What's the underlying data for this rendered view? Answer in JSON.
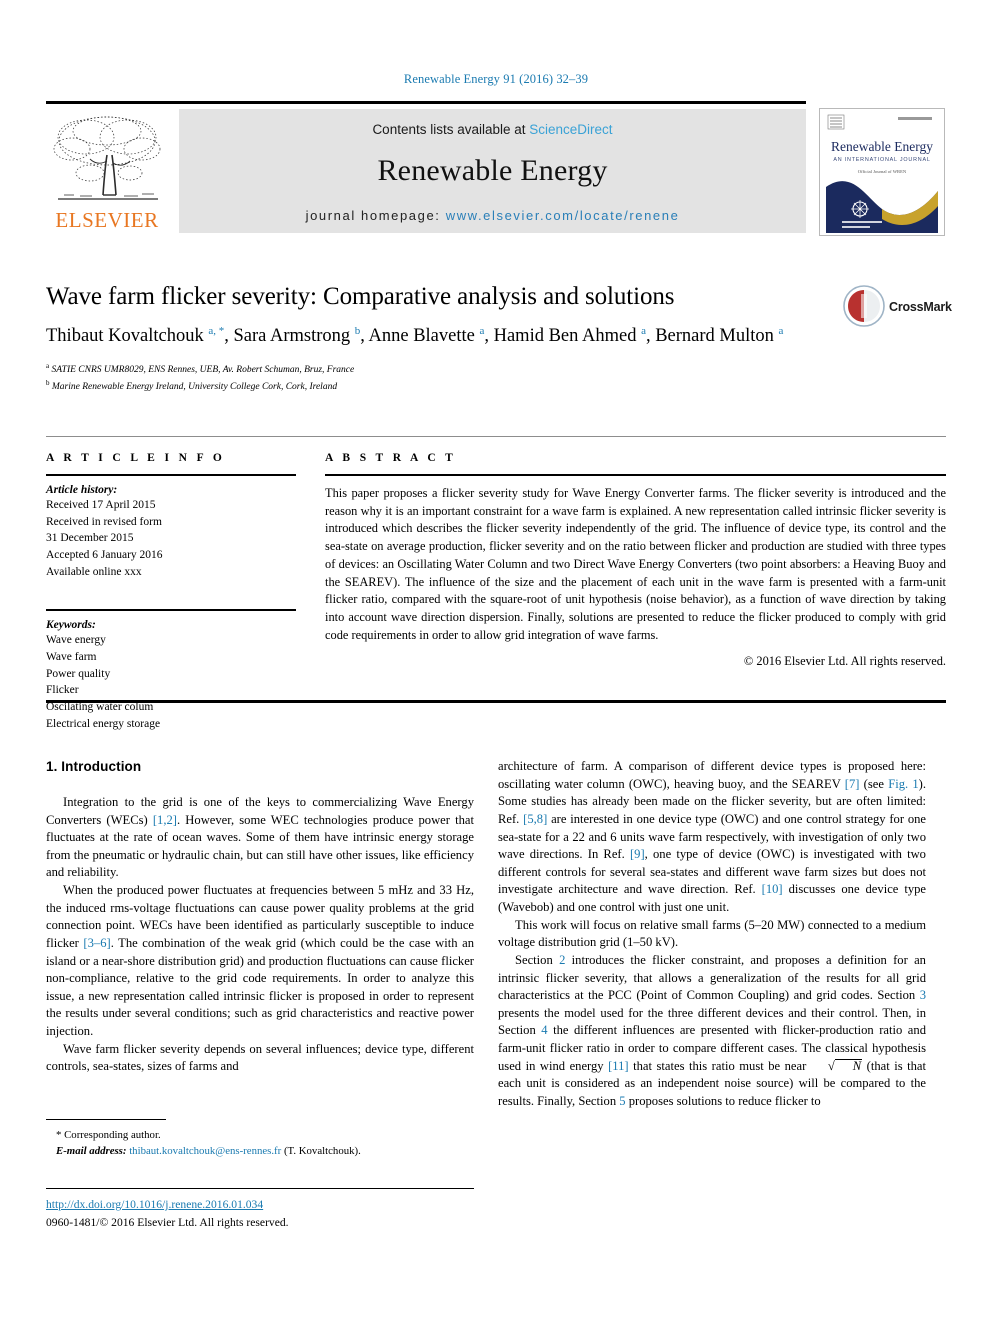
{
  "running_head": "Renewable Energy 91 (2016) 32–39",
  "masthead": {
    "contents_prefix": "Contents lists available at ",
    "contents_link": "ScienceDirect",
    "journal_name": "Renewable Energy",
    "homepage_prefix": "journal homepage: ",
    "homepage_url": "www.elsevier.com/locate/renene",
    "publisher": "ELSEVIER",
    "cover": {
      "title": "Renewable Energy",
      "subtitle": "AN INTERNATIONAL JOURNAL",
      "tagline": "Official Journal of WREN"
    }
  },
  "crossmark": {
    "label": "CrossMark"
  },
  "article": {
    "title": "Wave farm flicker severity: Comparative analysis and solutions",
    "authors_html": "Thibaut Kovaltchouk <sup>a, *</sup>, Sara Armstrong <sup>b</sup>, Anne Blavette <sup>a</sup>, Hamid Ben Ahmed <sup>a</sup>, Bernard Multon <sup>a</sup>",
    "affiliations": [
      {
        "marker": "a",
        "text": "SATIE CNRS UMR8029, ENS Rennes, UEB, Av. Robert Schuman, Bruz, France"
      },
      {
        "marker": "b",
        "text": "Marine Renewable Energy Ireland, University College Cork, Cork, Ireland"
      }
    ]
  },
  "article_info": {
    "heading": "A R T I C L E   I N F O",
    "history_label": "Article history:",
    "history": [
      "Received 17 April 2015",
      "Received in revised form",
      "31 December 2015",
      "Accepted 6 January 2016",
      "Available online xxx"
    ],
    "keywords_label": "Keywords:",
    "keywords": [
      "Wave energy",
      "Wave farm",
      "Power quality",
      "Flicker",
      "Oscilating water colum",
      "Electrical energy storage"
    ]
  },
  "abstract": {
    "heading": "A B S T R A C T",
    "text": "This paper proposes a flicker severity study for Wave Energy Converter farms. The flicker severity is introduced and the reason why it is an important constraint for a wave farm is explained. A new representation called intrinsic flicker severity is introduced which describes the flicker severity independently of the grid. The influence of device type, its control and the sea-state on average production, flicker severity and on the ratio between flicker and production are studied with three types of devices: an Oscillating Water Column and two Direct Wave Energy Converters (two point absorbers: a Heaving Buoy and the SEAREV). The influence of the size and the placement of each unit in the wave farm is presented with a farm-unit flicker ratio, compared with the square-root of unit hypothesis (noise behavior), as a function of wave direction by taking into account wave direction dispersion. Finally, solutions are presented to reduce the flicker produced to comply with grid code requirements in order to allow grid integration of wave farms.",
    "copyright": "© 2016 Elsevier Ltd. All rights reserved."
  },
  "body": {
    "section_heading": "1. Introduction",
    "left_paragraphs": [
      "Integration to the grid is one of the keys to commercializing Wave Energy Converters (WECs) [1,2]. However, some WEC technologies produce power that fluctuates at the rate of ocean waves. Some of them have intrinsic energy storage from the pneumatic or hydraulic chain, but can still have other issues, like efficiency and reliability.",
      "When the produced power fluctuates at frequencies between 5 mHz and 33 Hz, the induced rms-voltage fluctuations can cause power quality problems at the grid connection point. WECs have been identified as particularly susceptible to induce flicker [3–6]. The combination of the weak grid (which could be the case with an island or a near-shore distribution grid) and production fluctuations can cause flicker non-compliance, relative to the grid code requirements. In order to analyze this issue, a new representation called intrinsic flicker is proposed in order to represent the results under several conditions; such as grid characteristics and reactive power injection.",
      "Wave farm flicker severity depends on several influences; device type, different controls, sea-states, sizes of farms and"
    ],
    "right_paragraphs": [
      "architecture of farm. A comparison of different device types is proposed here: oscillating water column (OWC), heaving buoy, and the SEAREV [7] (see Fig. 1). Some studies has already been made on the flicker severity, but are often limited: Ref. [5,8] are interested in one device type (OWC) and one control strategy for one sea-state for a 22 and 6 units wave farm respectively, with investigation of only two wave directions. In Ref. [9], one type of device (OWC) is investigated with two different controls for several sea-states and different wave farm sizes but does not investigate architecture and wave direction. Ref. [10] discusses one device type (Wavebob) and one control with just one unit.",
      "This work will focus on relative small farms (5–20 MW) connected to a medium voltage distribution grid (1–50 kV).",
      "Section 2 introduces the flicker constraint, and proposes a definition for an intrinsic flicker severity, that allows a generalization of the results for all grid characteristics at the PCC (Point of Common Coupling) and grid codes. Section 3 presents the model used for the three different devices and their control. Then, in Section 4 the different influences are presented with flicker-production ratio and farm-unit flicker ratio in order to compare different cases. The classical hypothesis used in wind energy [11] that states this ratio must be near √N (that is that each unit is considered as an independent noise source) will be compared to the results. Finally, Section 5 proposes solutions to reduce flicker to"
    ]
  },
  "footnote": {
    "corresponding": "* Corresponding author.",
    "email_label": "E-mail address:",
    "email": "thibaut.kovaltchouk@ens-rennes.fr",
    "email_suffix": "(T. Kovaltchouk)."
  },
  "footer": {
    "doi": "http://dx.doi.org/10.1016/j.renene.2016.01.034",
    "issn": "0960-1481/© 2016 Elsevier Ltd. All rights reserved."
  },
  "colors": {
    "link_blue": "#1a7ab0",
    "sciencedirect_blue": "#3aa2d6",
    "elsevier_orange": "#e87722",
    "cover_navy": "#1b2a5e",
    "cover_gold": "#c8a22c",
    "crossmark_red": "#b8312f"
  }
}
